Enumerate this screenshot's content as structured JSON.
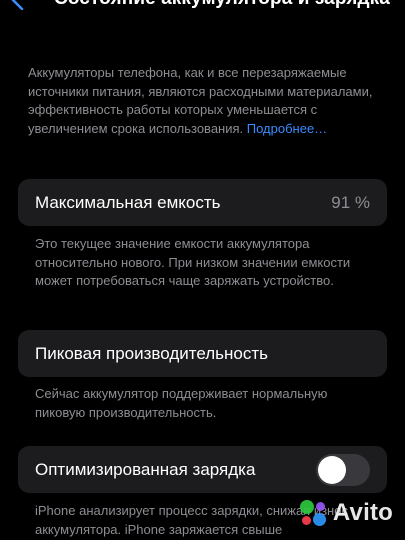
{
  "nav": {
    "title": "Состояние аккумулятора и зарядка",
    "back_icon": "chevron-left-icon"
  },
  "intro": {
    "text": "Аккумуляторы телефона, как и все перезаряжаемые источники питания, являются расходными материалами, эффективность работы которых уменьшается с увеличением срока использования.",
    "link_label": "Подробнее…"
  },
  "max_capacity": {
    "label": "Максимальная емкость",
    "value": "91 %",
    "description": "Это текущее значение емкости аккумулятора относительно нового. При низком значении емкости может потребоваться чаще заряжать устройство."
  },
  "peak_performance": {
    "label": "Пиковая производительность",
    "description": "Сейчас аккумулятор поддерживает нормальную пиковую производительность."
  },
  "optimized_charging": {
    "label": "Оптимизированная зарядка",
    "enabled": false,
    "description": "iPhone анализирует процесс зарядки, снижая износ аккумулятора. iPhone заряжается свыше"
  },
  "watermark": {
    "text": "Avito",
    "icon": "avito-logo-icon"
  },
  "colors": {
    "background": "#000000",
    "card": "#1c1c1e",
    "secondary_text": "#8d8d93",
    "link": "#3a8cff",
    "toggle_off": "#39393d"
  }
}
